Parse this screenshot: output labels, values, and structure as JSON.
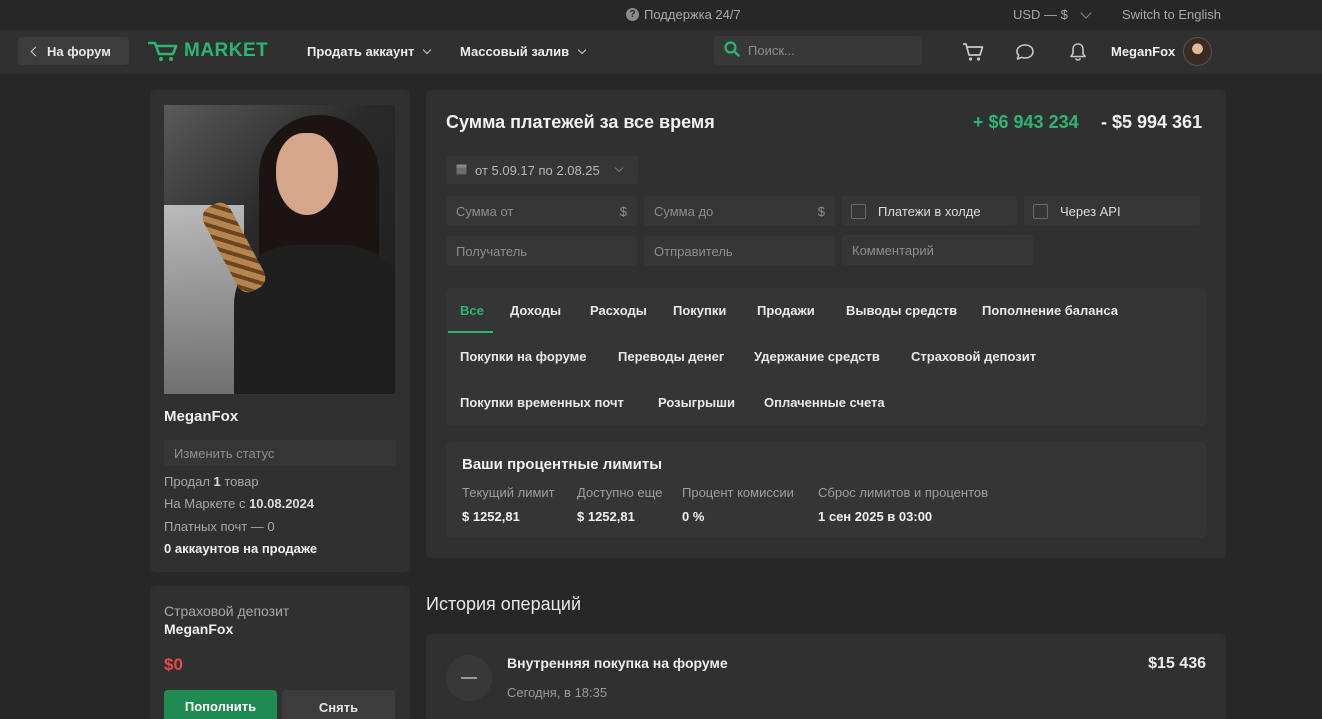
{
  "topbar": {
    "support": "Поддержка 24/7",
    "currency": "USD — $",
    "language": "Switch to English"
  },
  "header": {
    "back": "На форум",
    "logo": "MARKET",
    "menu": [
      "Продать аккаунт",
      "Массовый залив"
    ],
    "search_placeholder": "Поиск...",
    "username": "MeganFox"
  },
  "profile": {
    "name": "MeganFox",
    "status_placeholder": "Изменить статус",
    "sold_prefix": "Продал ",
    "sold_count": "1",
    "sold_suffix": " товар",
    "since_prefix": "На Маркете с ",
    "since_date": "10.08.2024",
    "paid_mail": "Платных почт — 0",
    "accounts_on_sale": "0 аккаунтов на продаже"
  },
  "deposit": {
    "title": "Страховой депозит",
    "user": "MeganFox",
    "amount": "$0",
    "topup": "Пополнить",
    "withdraw": "Снять"
  },
  "payments": {
    "title": "Сумма платежей за все время",
    "income": "+ $6 943 234",
    "expense": "- $5 994 361",
    "date_range": "от 5.09.17 по 2.08.25",
    "filters": {
      "sum_from": "Сумма от",
      "sum_to": "Сумма до",
      "currency_sign": "$",
      "hold": "Платежи в холде",
      "api": "Через API",
      "receiver": "Получатель",
      "sender": "Отправитель",
      "comment": "Комментарий"
    },
    "tabs": [
      "Все",
      "Доходы",
      "Расходы",
      "Покупки",
      "Продажи",
      "Выводы средств",
      "Пополнение баланса",
      "Покупки на форуме",
      "Переводы денег",
      "Удержание средств",
      "Страховой депозит",
      "Покупки временных почт",
      "Розыгрыши",
      "Оплаченные счета"
    ]
  },
  "limits": {
    "title": "Ваши процентные лимиты",
    "items": [
      {
        "label": "Текущий лимит",
        "value": "$ 1252,81"
      },
      {
        "label": "Доступно еще",
        "value": "$ 1252,81"
      },
      {
        "label": "Процент комиссии",
        "value": "0 %"
      },
      {
        "label": "Сброс лимитов и процентов",
        "value": "1 сен 2025 в 03:00"
      }
    ]
  },
  "history": {
    "title": "История операций",
    "operations": [
      {
        "title": "Внутренняя покупка на форуме",
        "time": "Сегодня, в 18:35",
        "amount": "$15 436"
      }
    ]
  },
  "colors": {
    "accent": "#2bb673",
    "negative": "#e14b4b",
    "background": "#272727",
    "card": "#303030"
  }
}
